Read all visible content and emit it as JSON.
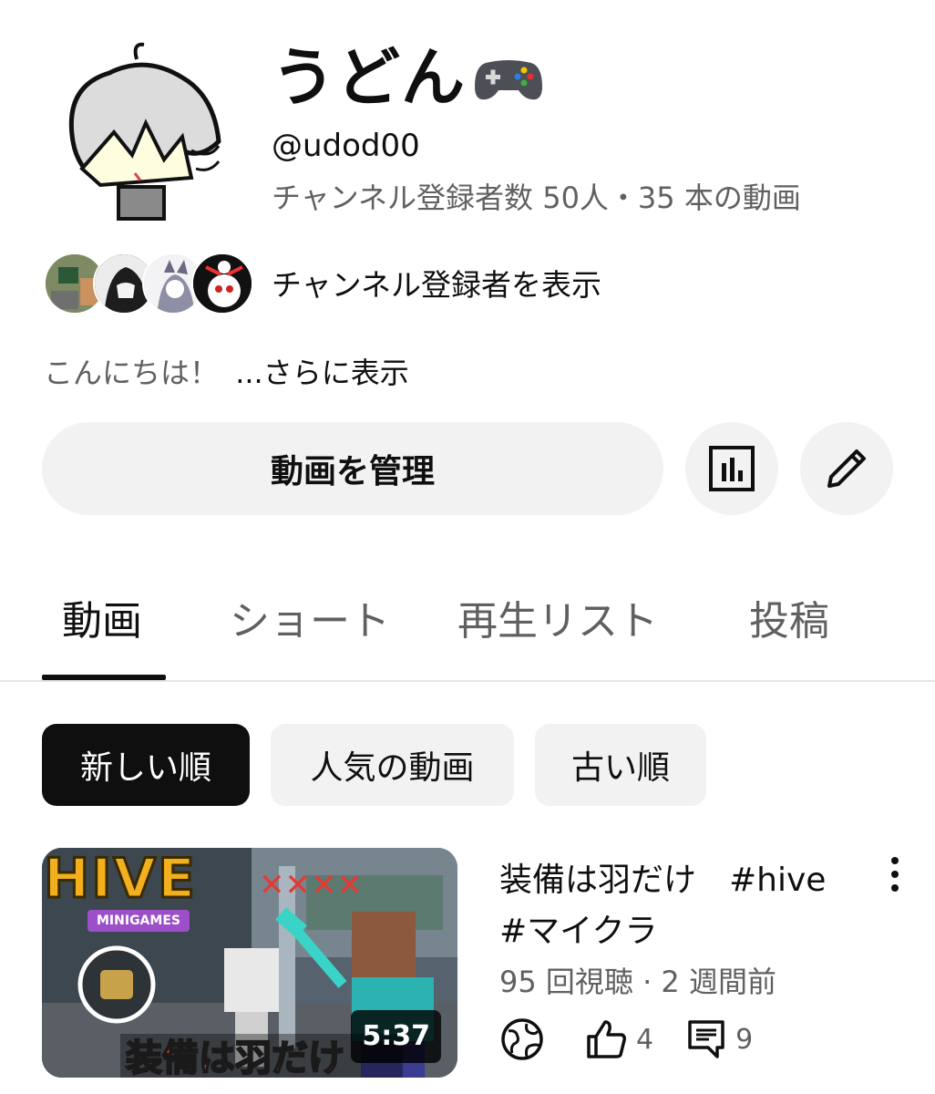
{
  "channel": {
    "name": "うどん",
    "name_icon": "gamepad-icon",
    "handle": "@udod00",
    "stats": "チャンネル登録者数 50人・35 本の動画"
  },
  "subscribers": {
    "link_label": "チャンネル登録者を表示",
    "avatar_colors": [
      "#9aa57a",
      "#2a2a2a",
      "#c9c9d6",
      "#111111"
    ]
  },
  "description": {
    "text": "こんにちは！",
    "more_label": "...さらに表示"
  },
  "actions": {
    "manage_label": "動画を管理",
    "analytics_icon": "analytics-icon",
    "edit_icon": "pencil-icon"
  },
  "tabs": [
    {
      "label": "動画",
      "active": true
    },
    {
      "label": "ショート",
      "active": false
    },
    {
      "label": "再生リスト",
      "active": false
    },
    {
      "label": "投稿",
      "active": false
    }
  ],
  "sort_chips": [
    {
      "label": "新しい順",
      "selected": true
    },
    {
      "label": "人気の動画",
      "selected": false
    },
    {
      "label": "古い順",
      "selected": false
    }
  ],
  "videos": [
    {
      "title_line1": "装備は羽だけ　#hive",
      "title_line2": "#マイクラ",
      "meta": "95 回視聴 · 2 週間前",
      "duration": "5:37",
      "likes": "4",
      "comments": "9",
      "thumb_logo": "HIVE",
      "thumb_sub": "MINIGAMES",
      "thumb_caption": "装備は羽だけ",
      "visibility_icon": "globe-icon"
    }
  ],
  "colors": {
    "text_primary": "#0f0f0f",
    "text_secondary": "#606060",
    "chip_bg": "#f2f2f2",
    "chip_selected_bg": "#0f0f0f"
  }
}
